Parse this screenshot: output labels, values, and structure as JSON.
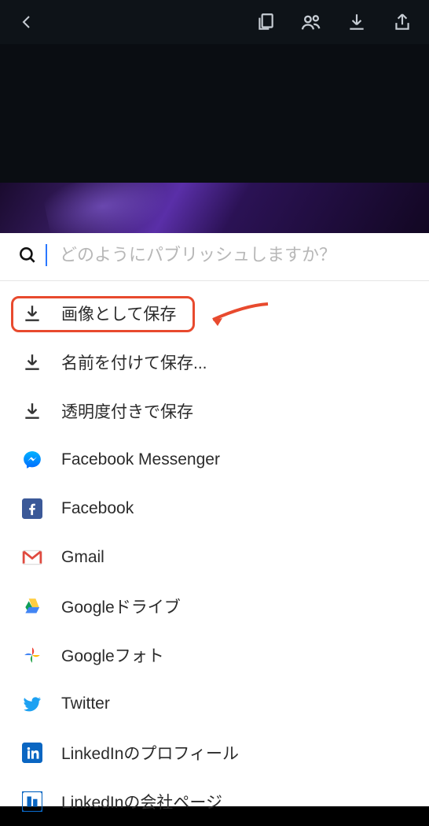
{
  "search": {
    "placeholder": "どのようにパブリッシュしますか？"
  },
  "annotation": {
    "highlight_color": "#e84a2e"
  },
  "options": [
    {
      "icon": "download",
      "label": "画像として保存"
    },
    {
      "icon": "download",
      "label": "名前を付けて保存..."
    },
    {
      "icon": "download",
      "label": "透明度付きで保存"
    },
    {
      "icon": "messenger",
      "label": "Facebook Messenger"
    },
    {
      "icon": "facebook",
      "label": "Facebook"
    },
    {
      "icon": "gmail",
      "label": "Gmail"
    },
    {
      "icon": "gdrive",
      "label": "Googleドライブ"
    },
    {
      "icon": "gphotos",
      "label": "Googleフォト"
    },
    {
      "icon": "twitter",
      "label": "Twitter"
    },
    {
      "icon": "linkedin",
      "label": "LinkedInのプロフィール"
    },
    {
      "icon": "linkedin-company",
      "label": "LinkedInの会社ページ"
    }
  ]
}
